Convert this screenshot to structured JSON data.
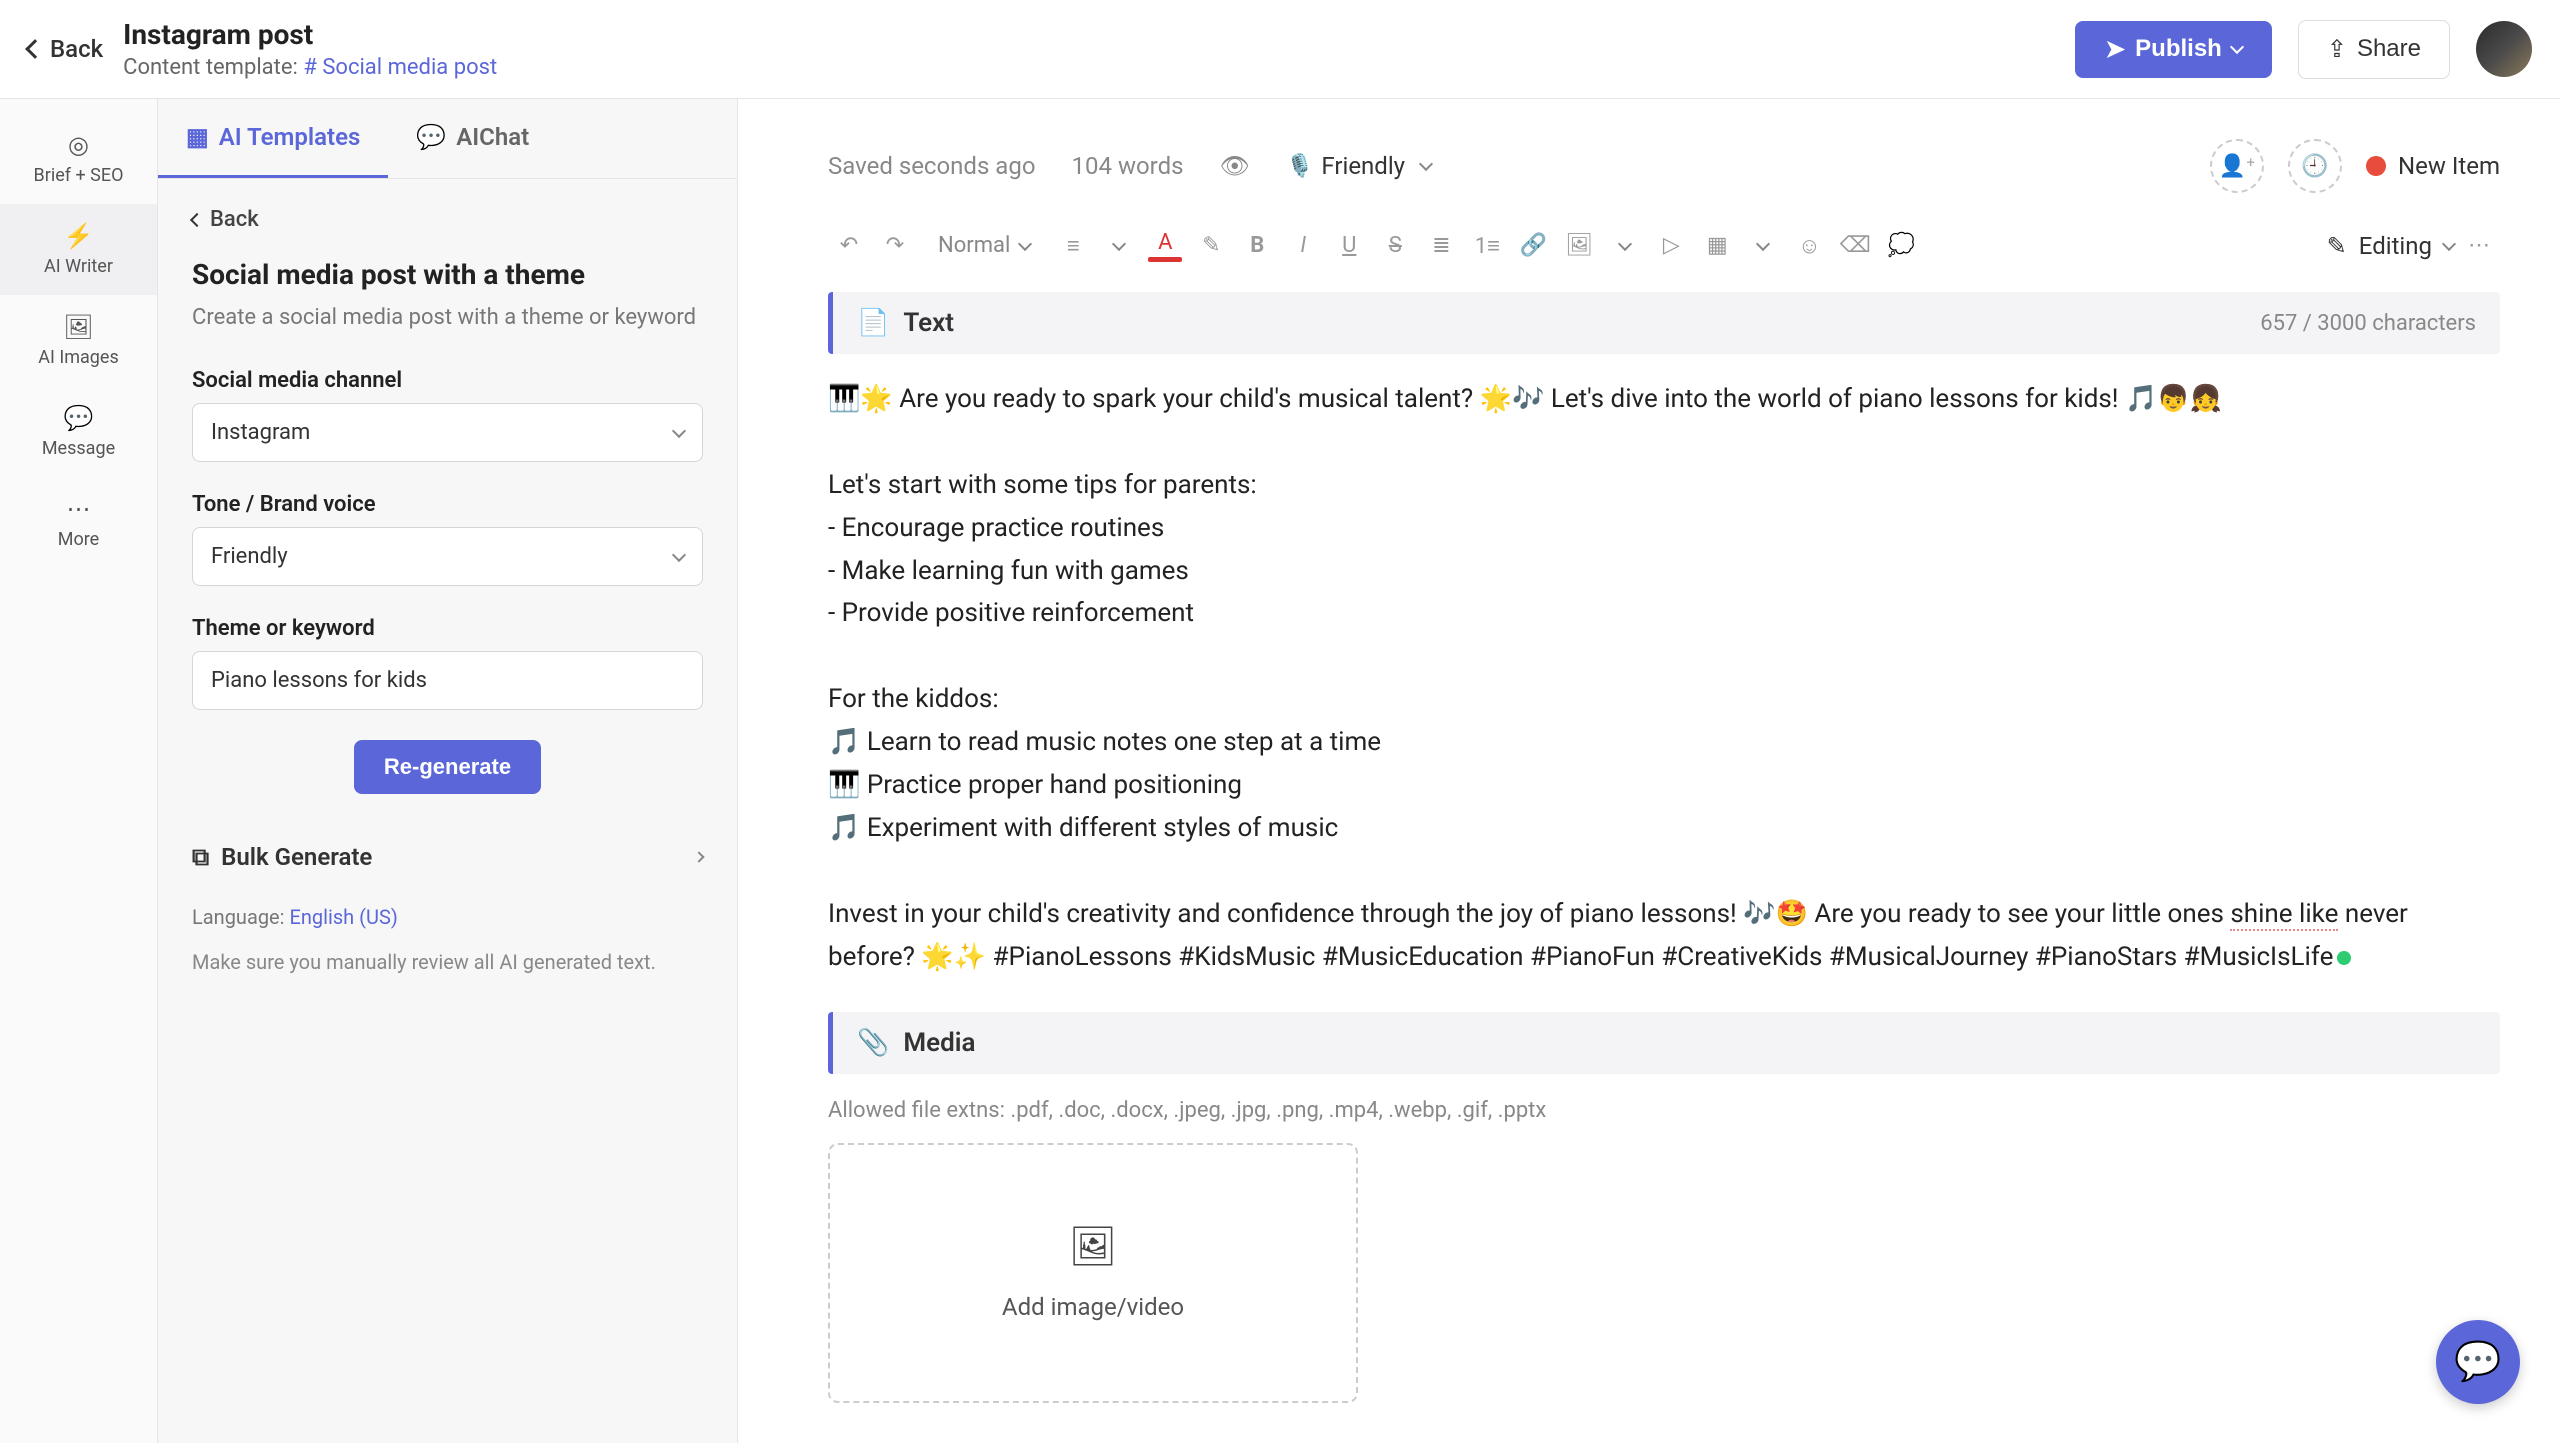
{
  "header": {
    "back": "Back",
    "title": "Instagram post",
    "template_label": "Content template:",
    "template_link": "Social media post",
    "publish": "Publish",
    "share": "Share"
  },
  "rail": {
    "items": [
      {
        "icon": "◎",
        "label": "Brief + SEO"
      },
      {
        "icon": "⚡",
        "label": "AI Writer"
      },
      {
        "icon": "🖼",
        "label": "AI Images"
      },
      {
        "icon": "💬",
        "label": "Message"
      },
      {
        "icon": "⋯",
        "label": "More"
      }
    ],
    "active_index": 1
  },
  "panel": {
    "tabs": {
      "templates": "AI Templates",
      "chat": "AIChat"
    },
    "back": "Back",
    "heading": "Social media post with a theme",
    "subheading": "Create a social media post with a theme or keyword",
    "channel_label": "Social media channel",
    "channel_value": "Instagram",
    "tone_label": "Tone / Brand voice",
    "tone_value": "Friendly",
    "theme_label": "Theme or keyword",
    "theme_value": "Piano lessons for kids",
    "regenerate": "Re-generate",
    "bulk": "Bulk Generate",
    "language_label": "Language:",
    "language_value": "English (US)",
    "review_note": "Make sure you manually review all AI generated text."
  },
  "workspace": {
    "saved": "Saved seconds ago",
    "word_count": "104 words",
    "tone_badge": "Friendly",
    "status": "New Item",
    "format_select": "Normal",
    "editing_label": "Editing",
    "text_block": {
      "label": "Text",
      "char_count": "657 / 3000 characters",
      "body_1": "🎹🌟 Are you ready to spark your child's musical talent? 🌟🎶 Let's dive into the world of piano lessons for kids! 🎵👦👧",
      "body_2": "Let's start with some tips for parents:\n- Encourage practice routines\n- Make learning fun with games\n- Provide positive reinforcement",
      "body_3": "For the kiddos:\n🎵 Learn to read music notes one step at a time\n🎹 Practice proper hand positioning\n🎵 Experiment with different styles of music",
      "body_4a": "Invest in your child's creativity and confidence through the joy of piano lessons! 🎶🤩 Are you ready to see your little ones ",
      "body_4b": "shine like",
      "body_4c": " never before? 🌟✨ #PianoLessons #KidsMusic #MusicEducation #PianoFun #CreativeKids #MusicalJourney #PianoStars #MusicIsLife"
    },
    "media_block": {
      "label": "Media",
      "allowed": "Allowed file extns: .pdf, .doc, .docx, .jpeg, .jpg, .png, .mp4, .webp, .gif, .pptx",
      "add_label": "Add image/video"
    }
  }
}
